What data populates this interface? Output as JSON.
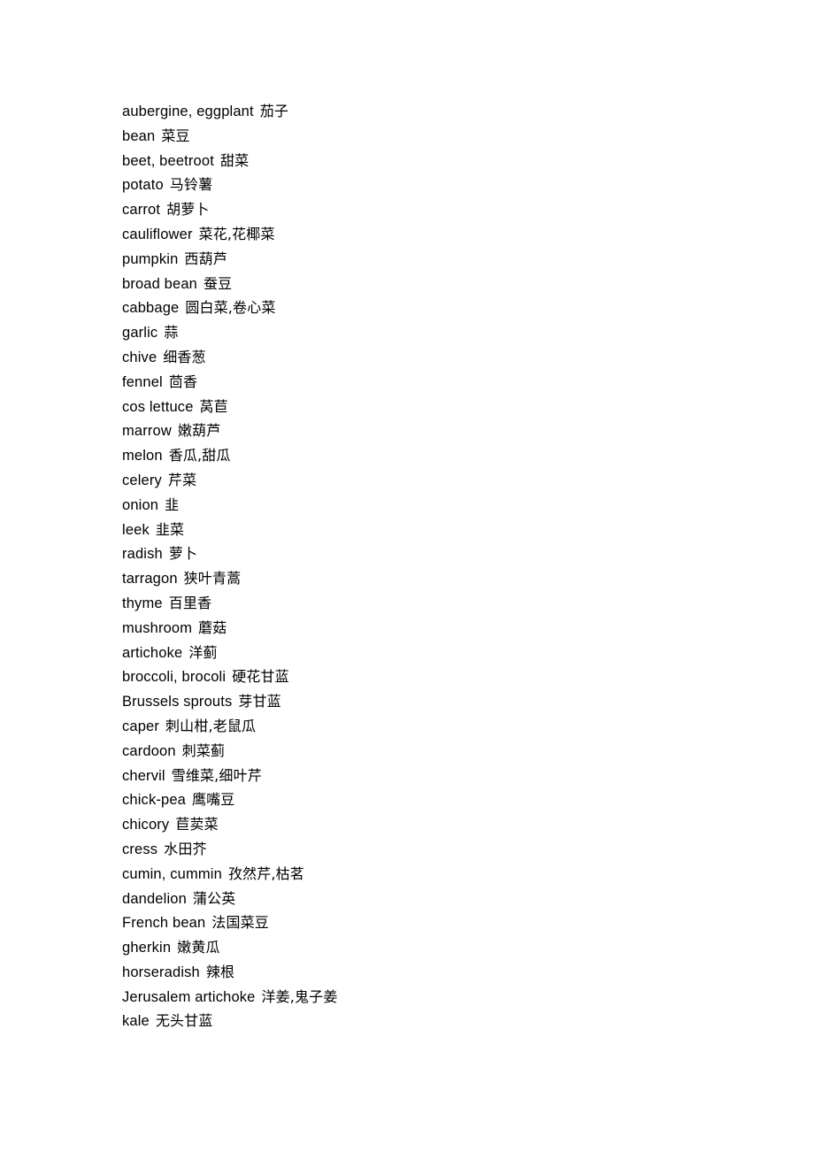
{
  "document": {
    "type": "word-list",
    "topic": "vegetables",
    "background_color": "#ffffff",
    "text_color": "#000000"
  },
  "glossary": {
    "entries": [
      {
        "term": "aubergine,  eggplant",
        "gloss": "茄子"
      },
      {
        "term": "bean",
        "gloss": "菜豆"
      },
      {
        "term": "beet,  beetroot",
        "gloss": "甜菜"
      },
      {
        "term": "potato",
        "gloss": "马铃薯"
      },
      {
        "term": "carrot",
        "gloss": "胡萝卜"
      },
      {
        "term": "cauliflower",
        "gloss": "菜花,花椰菜"
      },
      {
        "term": "pumpkin",
        "gloss": "西葫芦"
      },
      {
        "term": "broad  bean",
        "gloss": "蚕豆"
      },
      {
        "term": "cabbage",
        "gloss": "圆白菜,卷心菜"
      },
      {
        "term": "garlic",
        "gloss": "蒜"
      },
      {
        "term": "chive",
        "gloss": "细香葱"
      },
      {
        "term": "fennel",
        "gloss": "茴香"
      },
      {
        "term": "cos  lettuce",
        "gloss": "莴苣"
      },
      {
        "term": "marrow",
        "gloss": "嫩葫芦"
      },
      {
        "term": "melon",
        "gloss": "香瓜,甜瓜"
      },
      {
        "term": "celery",
        "gloss": "芹菜"
      },
      {
        "term": "onion",
        "gloss": "韭"
      },
      {
        "term": "leek",
        "gloss": "韭菜"
      },
      {
        "term": "radish",
        "gloss": "萝卜"
      },
      {
        "term": "tarragon",
        "gloss": "狭叶青蒿"
      },
      {
        "term": "thyme",
        "gloss": "百里香"
      },
      {
        "term": "mushroom",
        "gloss": "蘑菇"
      },
      {
        "term": "artichoke",
        "gloss": "洋蓟"
      },
      {
        "term": "broccoli,  brocoli",
        "gloss": "硬花甘蓝"
      },
      {
        "term": "Brussels  sprouts",
        "gloss": "芽甘蓝"
      },
      {
        "term": "caper",
        "gloss": "刺山柑,老鼠瓜"
      },
      {
        "term": "cardoon",
        "gloss": "刺菜蓟"
      },
      {
        "term": "chervil",
        "gloss": "雪维菜,细叶芹"
      },
      {
        "term": "chick-pea",
        "gloss": "鹰嘴豆"
      },
      {
        "term": "chicory",
        "gloss": "苣荬菜"
      },
      {
        "term": "cress",
        "gloss": "水田芥"
      },
      {
        "term": "cumin,  cummin",
        "gloss": "孜然芹,枯茗"
      },
      {
        "term": "dandelion",
        "gloss": "蒲公英"
      },
      {
        "term": "French  bean",
        "gloss": "法国菜豆"
      },
      {
        "term": "gherkin",
        "gloss": "嫩黄瓜"
      },
      {
        "term": "horseradish",
        "gloss": "辣根"
      },
      {
        "term": "Jerusalem  artichoke",
        "gloss": "洋姜,鬼子姜"
      },
      {
        "term": "kale",
        "gloss": "无头甘蓝"
      }
    ]
  }
}
